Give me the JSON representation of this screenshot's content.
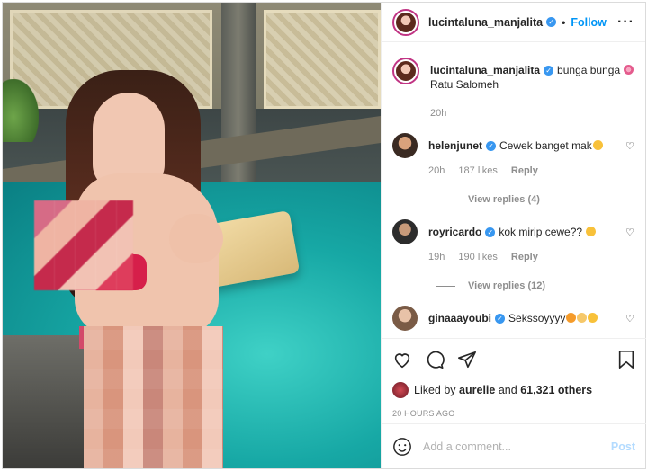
{
  "post": {
    "author": "lucintaluna_manjalita",
    "follow_label": "Follow",
    "dot": "•",
    "more_label": "···",
    "caption_text": "bunga bunga",
    "caption_line2": "Ratu Salomeh",
    "caption_time": "20h"
  },
  "comments": [
    {
      "user": "helenjunet",
      "text": "Cewek banget mak",
      "time": "20h",
      "likes": "187 likes",
      "reply": "Reply",
      "view_replies": "View replies (4)"
    },
    {
      "user": "royricardo",
      "text": "kok mirip cewe??",
      "time": "19h",
      "likes": "190 likes",
      "reply": "Reply",
      "view_replies": "View replies (12)"
    },
    {
      "user": "ginaaayoubi",
      "text": "Sekssoyyyy"
    }
  ],
  "likes": {
    "prefix": "Liked by",
    "user": "aurelie",
    "and": "and",
    "count": "61,321 others"
  },
  "timestamp": "20 HOURS AGO",
  "add_comment": {
    "placeholder": "Add a comment...",
    "post_label": "Post"
  },
  "colors": {
    "accent": "#0095f6",
    "verified": "#3897f0",
    "muted": "#8e8e8e",
    "post_disabled": "#b3dbff"
  }
}
